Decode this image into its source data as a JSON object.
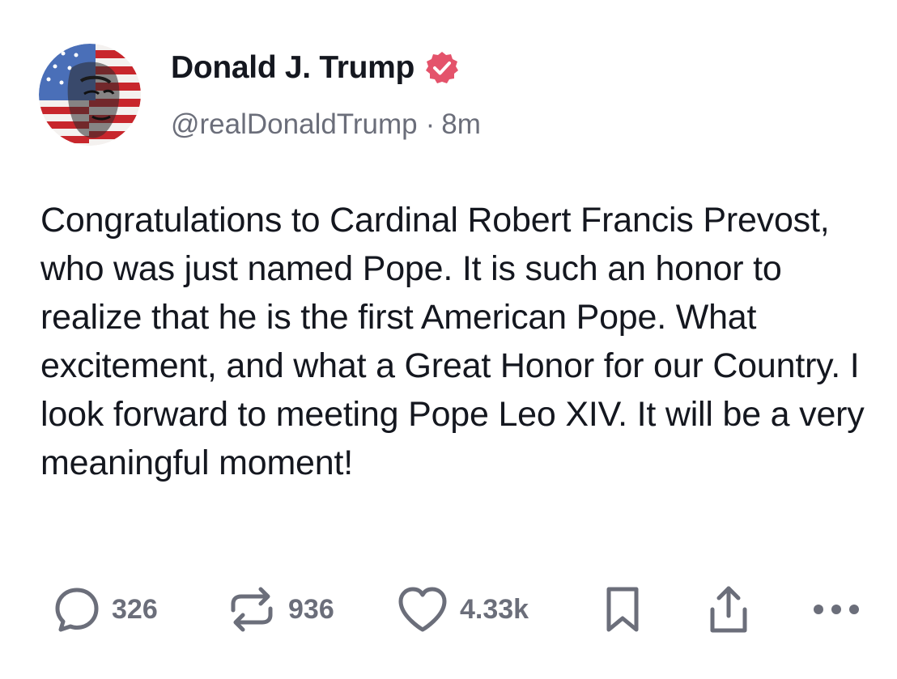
{
  "author": {
    "display_name": "Donald J. Trump",
    "handle": "@realDonaldTrump",
    "separator": "·",
    "time_ago": "8m",
    "verified_color": "#e4536b"
  },
  "post": {
    "text": "Congratulations to Cardinal Robert Francis Prevost, who was just named Pope. It is such an honor to realize that he is the first American Pope. What excitement, and what a Great Honor for our Country. I look forward to meeting Pope Leo XIV. It will be a very meaningful moment!"
  },
  "actions": {
    "replies": "326",
    "retruths": "936",
    "likes": "4.33k",
    "icons": [
      "reply-icon",
      "retruth-icon",
      "like-icon",
      "bookmark-icon",
      "share-icon",
      "more-icon"
    ],
    "icon_color": "#6b6e7a"
  }
}
